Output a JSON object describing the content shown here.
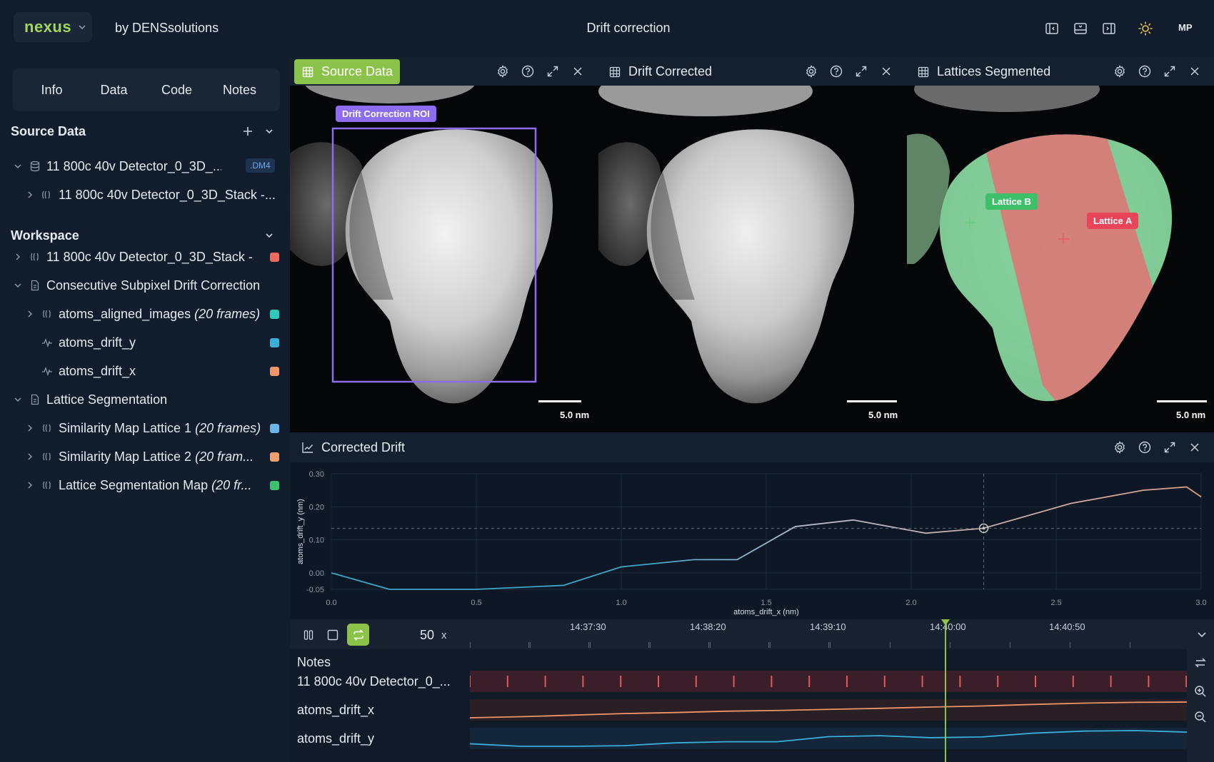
{
  "app": {
    "brand": "nexus",
    "byline": "by DENSsolutions",
    "title": "Drift correction",
    "user_initials": "MP",
    "accent": "#a3d65c"
  },
  "sidebar": {
    "tabs": [
      {
        "label": "Info"
      },
      {
        "label": "Data"
      },
      {
        "label": "Code"
      },
      {
        "label": "Notes"
      }
    ],
    "source_section": {
      "title": "Source Data",
      "file": {
        "label": "11 800c 40v Detector_0_3D_...",
        "badge": ".DM4"
      },
      "child": {
        "label": "11 800c 40v Detector_0_3D_Stack -..."
      }
    },
    "workspace_section": {
      "title": "Workspace",
      "items": [
        {
          "label": "11 800c 40v Detector_0_3D_Stack -",
          "italic": "",
          "color": "#f0695f",
          "icon": "stack-icon"
        },
        {
          "label": "Consecutive Subpixel Drift Correction",
          "italic": "",
          "color": "",
          "icon": "document-icon"
        },
        {
          "label": "atoms_aligned_images ",
          "italic": "(20 frames)",
          "color": "#2fc9b9",
          "icon": "stack-icon"
        },
        {
          "label": "atoms_drift_y",
          "italic": "",
          "color": "#3ab0d9",
          "icon": "signal-icon"
        },
        {
          "label": "atoms_drift_x",
          "italic": "",
          "color": "#f0956a",
          "icon": "signal-icon"
        },
        {
          "label": "Lattice Segmentation",
          "italic": "",
          "color": "",
          "icon": "document-icon"
        },
        {
          "label": "Similarity Map Lattice 1 ",
          "italic": "(20 frames)",
          "color": "#6ab4e8",
          "icon": "stack-icon"
        },
        {
          "label": "Similarity Map Lattice 2 ",
          "italic": "(20 fram...",
          "color": "#f0a070",
          "icon": "stack-icon"
        },
        {
          "label": "Lattice Segmentation Map ",
          "italic": "(20 fr...",
          "color": "#3dbf6e",
          "icon": "stack-icon"
        }
      ]
    }
  },
  "panels": {
    "source": {
      "title": "Source Data",
      "roi_label": "Drift Correction ROI",
      "scale": "5.0 nm"
    },
    "corrected": {
      "title": "Drift Corrected",
      "scale": "5.0 nm"
    },
    "segmented": {
      "title": "Lattices Segmented",
      "scale": "5.0 nm",
      "lattice_b": "Lattice B",
      "lattice_a": "Lattice A"
    }
  },
  "drift_panel": {
    "title": "Corrected Drift"
  },
  "chart_data": {
    "type": "line",
    "xlabel": "atoms_drift_x (nm)",
    "ylabel": "atoms_drift_y (nm)",
    "xlim": [
      0,
      3.0
    ],
    "ylim": [
      -0.05,
      0.3
    ],
    "xticks": [
      "0.0",
      "0.5",
      "1.0",
      "1.5",
      "2.0",
      "2.5",
      "3.0"
    ],
    "yticks": [
      "0.30",
      "0.20",
      "0.10",
      "0.00",
      "-0.05"
    ],
    "grid": true,
    "series": [
      {
        "x": [
          0.0,
          0.2,
          0.5,
          0.8,
          1.0,
          1.25,
          1.4,
          1.6,
          1.8,
          2.05,
          2.25,
          2.55,
          2.8,
          2.95,
          3.0
        ],
        "y": [
          0.0,
          -0.05,
          -0.05,
          -0.038,
          0.018,
          0.04,
          0.04,
          0.14,
          0.16,
          0.12,
          0.135,
          0.21,
          0.25,
          0.26,
          0.23
        ],
        "color_low": "#3aa6c8",
        "color_high": "#d9a089"
      }
    ],
    "marker": {
      "x": 2.25,
      "y": 0.135
    }
  },
  "timeline": {
    "speed": "50",
    "speed_unit": "x",
    "times": [
      "14:37:30",
      "14:38:20",
      "14:39:10",
      "14:40:00",
      "14:40:50"
    ],
    "track_header": "Notes",
    "tracks": [
      {
        "label": "11 800c 40v Detector_0_...",
        "kind": "frames",
        "frames": 20,
        "color": "#e05a5a"
      },
      {
        "label": "atoms_drift_x",
        "kind": "line",
        "color": "#f0956a",
        "values": [
          0.0,
          0.2,
          0.5,
          0.8,
          1.0,
          1.25,
          1.4,
          1.6,
          1.8,
          2.05,
          2.25,
          2.55,
          2.8,
          2.95,
          3.0
        ]
      },
      {
        "label": "atoms_drift_y",
        "kind": "line",
        "color": "#3ab0d9",
        "values": [
          0.0,
          -0.05,
          -0.05,
          -0.038,
          0.018,
          0.04,
          0.04,
          0.14,
          0.16,
          0.12,
          0.135,
          0.21,
          0.25,
          0.26,
          0.23
        ]
      }
    ],
    "playhead_time": "14:40:00"
  }
}
